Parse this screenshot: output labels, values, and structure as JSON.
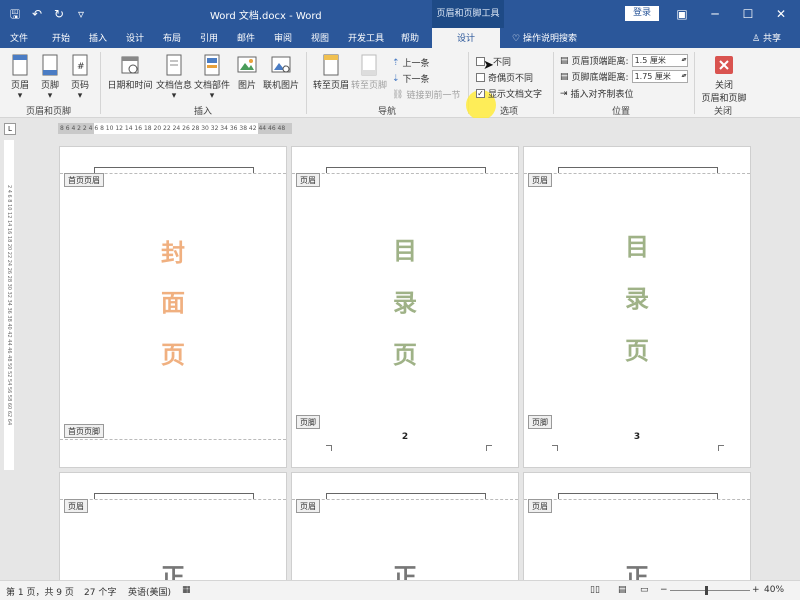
{
  "titlebar": {
    "title": "Word 文档.docx  -  Word",
    "context_tab": "页眉和页脚工具",
    "signin": "登录",
    "qat": [
      "save-icon",
      "undo-icon",
      "redo-icon",
      "customize-icon"
    ],
    "qat_glyphs": [
      "🖫",
      "↶",
      "↻",
      "▿"
    ],
    "window_buttons": [
      "▣",
      "─",
      "☐",
      "✕"
    ]
  },
  "tabs": [
    "文件",
    "开始",
    "插入",
    "设计",
    "布局",
    "引用",
    "邮件",
    "审阅",
    "视图",
    "开发工具",
    "帮助"
  ],
  "active_tab": "设计",
  "help_search": "操作说明搜索",
  "share": "共享",
  "ribbon": {
    "header_footer": {
      "buttons": [
        "页眉",
        "页脚",
        "页码"
      ],
      "label": "页眉和页脚"
    },
    "insert": {
      "buttons": [
        "日期和时间",
        "文档信息",
        "文档部件",
        "图片",
        "联机图片"
      ],
      "label": "插入"
    },
    "navigation": {
      "goto_header": "转至页眉",
      "goto_footer": "转至页脚",
      "prev": "上一条",
      "next": "下一条",
      "link_prev": "链接到前一节",
      "label": "导航"
    },
    "options": {
      "first_page_diff": "首页不同",
      "first_page_diff_visible": "不同",
      "odd_even_diff": "奇偶页不同",
      "odd_even_diff_visible": "奇偶页不同",
      "show_doc_text": "显示文档文字",
      "show_doc_text_checked": true,
      "label": "选项"
    },
    "position": {
      "header_top_label": "页眉顶端距离:",
      "header_top_value": "1.5 厘米",
      "footer_bottom_label": "页脚底端距离:",
      "footer_bottom_value": "1.75 厘米",
      "insert_align_tab": "插入对齐制表位",
      "label": "位置"
    },
    "close": {
      "button": "关闭\n页眉和页脚",
      "button_line1": "关闭",
      "button_line2": "页眉和页脚",
      "label": "关闭"
    }
  },
  "ruler": {
    "tab_selector": "L",
    "h_numbers": "8 6 4 2     2  4  6  8 10 12 14 16 18 20 22 24 26 28 30 32 34 36 38     42 44 46 48",
    "v_numbers": "2 4 6 8 10 12 14 16 18 20 22 24 26 28 30 32 34 36 38 40 42 44 46 48 50 52 54 56 58 60 62 64"
  },
  "pages": [
    {
      "header_tag": "首页页眉",
      "footer_tag": "首页页脚",
      "chars": [
        "封",
        "面",
        "页"
      ],
      "color": "#f0b080",
      "page_number": ""
    },
    {
      "header_tag": "页眉",
      "footer_tag": "页脚",
      "chars": [
        "目",
        "录",
        "页"
      ],
      "color": "#9fb287",
      "page_number": "2"
    },
    {
      "header_tag": "页眉",
      "footer_tag": "页脚",
      "chars": [
        "目",
        "录",
        "页"
      ],
      "color": "#9fb287",
      "page_number": "3"
    },
    {
      "header_tag": "页眉",
      "chars": [
        "正"
      ],
      "color": "#777777"
    },
    {
      "header_tag": "页眉",
      "chars": [
        "正"
      ],
      "color": "#777777"
    },
    {
      "header_tag": "页眉",
      "chars": [
        "正"
      ],
      "color": "#777777"
    }
  ],
  "statusbar": {
    "page_info": "第 1 页，共 9 页",
    "word_count": "27 个字",
    "language": "英语(美国)",
    "zoom": "40%"
  }
}
